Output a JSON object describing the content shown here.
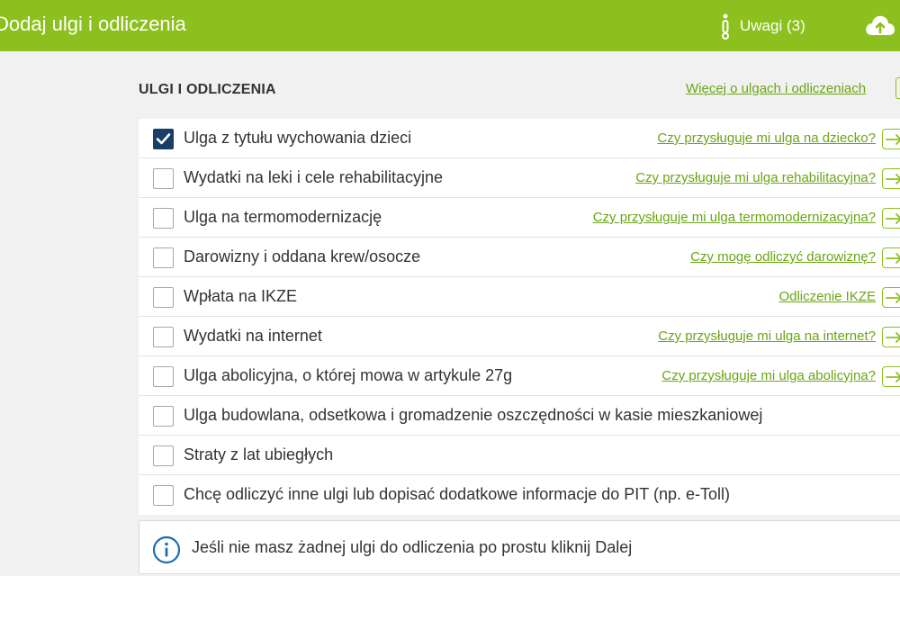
{
  "header": {
    "title": "Dodaj ulgi i odliczenia",
    "notes_label": "Uwagi (3)",
    "notes_icon": "info-exclamation-icon",
    "cloud_icon": "cloud-upload-icon"
  },
  "section": {
    "title": "ULGI I ODLICZENIA",
    "more_link": "Więcej o ulgach i odliczeniach"
  },
  "items": [
    {
      "label": "Ulga z tytułu wychowania dzieci",
      "checked": true,
      "help": "Czy przysługuje mi ulga na dziecko?"
    },
    {
      "label": "Wydatki na leki i cele rehabilitacyjne",
      "checked": false,
      "help": "Czy przysługuje mi ulga rehabilitacyjna?"
    },
    {
      "label": "Ulga na termomodernizację",
      "checked": false,
      "help": "Czy przysługuje mi ulga termomodernizacyjna?"
    },
    {
      "label": "Darowizny i oddana krew/osocze",
      "checked": false,
      "help": "Czy mogę odliczyć darowiznę?"
    },
    {
      "label": "Wpłata na IKZE",
      "checked": false,
      "help": "Odliczenie IKZE"
    },
    {
      "label": "Wydatki na internet",
      "checked": false,
      "help": "Czy przysługuje mi ulga na internet?"
    },
    {
      "label": "Ulga abolicyjna, o której mowa w artykule 27g",
      "checked": false,
      "help": "Czy przysługuje mi ulga abolicyjna?"
    },
    {
      "label": "Ulga budowlana, odsetkowa i gromadzenie oszczędności w kasie mieszkaniowej",
      "checked": false,
      "help": null
    },
    {
      "label": "Straty z lat ubiegłych",
      "checked": false,
      "help": null
    },
    {
      "label": "Chcę odliczyć inne ulgi lub dopisać dodatkowe informacje do PIT (np. e-Toll)",
      "checked": false,
      "help": null
    }
  ],
  "info": {
    "text": "Jeśli nie masz żadnej ulgi do odliczenia po prostu kliknij Dalej",
    "icon": "info-circle-icon"
  },
  "colors": {
    "brand_green": "#8cc01e",
    "link_green": "#6aa514",
    "checkbox_checked": "#1b3e66",
    "info_blue": "#1a6fb3"
  }
}
